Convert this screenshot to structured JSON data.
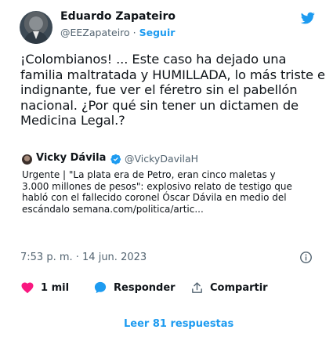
{
  "tweet": {
    "author_name": "Eduardo Zapateiro",
    "author_handle": "@EEZapateiro",
    "separator": " · ",
    "follow_label": "Seguir",
    "text_lines": [
      "¡Colombianos! ... Este caso ha dejado una",
      "familia maltratada y HUMILLADA, lo más triste e",
      "indignante, fue ver el féretro  sin el pabellón",
      "nacional. ¿Por qué sin tener un dictamen de",
      "Medicina Legal.?"
    ],
    "quoted": {
      "name": "Vicky Dávila",
      "handle": "@VickyDavilaH",
      "text_lines": [
        "Urgente | \"La plata era de Petro, eran cinco maletas y",
        "3.000 millones de pesos\": explosivo relato de testigo que",
        "habló con el fallecido coronel Óscar Dávila en medio del",
        "escándalo semana.com/politica/artic..."
      ]
    },
    "timestamp": "7:53 p. m. · 14 jun. 2023",
    "actions": {
      "like_count": "1 mil",
      "reply_label": "Responder",
      "share_label": "Compartir"
    },
    "read_replies_label": "Leer 81 respuestas"
  },
  "colors": {
    "accent": "#1d9bf0",
    "like": "#f91880",
    "text": "#0f1419",
    "secondary": "#536471"
  },
  "icons": [
    "twitter-bird-icon",
    "verified-badge-icon",
    "info-icon",
    "heart-icon",
    "reply-bubble-icon",
    "share-icon"
  ]
}
